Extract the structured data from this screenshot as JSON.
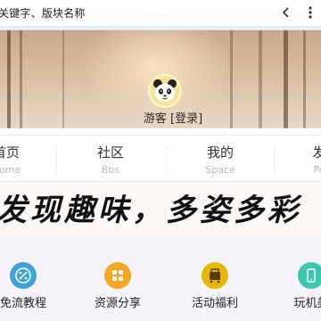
{
  "search": {
    "placeholder_text": "关键字、版块名称"
  },
  "profile": {
    "username": "游客",
    "login_label": "[登录]"
  },
  "nav": [
    {
      "label": "首页",
      "sub": "Home"
    },
    {
      "label": "社区",
      "sub": "Bbs"
    },
    {
      "label": "我的",
      "sub": "Space"
    },
    {
      "label": "发",
      "sub": "Po"
    }
  ],
  "slogan": {
    "text": "发现趣味，多姿多彩"
  },
  "quick_links": [
    {
      "label": "免流教程",
      "icon": "percent-ticket-icon",
      "color": "#3fa3d8"
    },
    {
      "label": "资源分享",
      "icon": "grid-apps-icon",
      "color": "#f5a623"
    },
    {
      "label": "活动福利",
      "icon": "gift-cart-icon",
      "color": "#e6b800"
    },
    {
      "label": "玩机美",
      "icon": "phone-icon",
      "color": "#3cc7b0"
    }
  ]
}
